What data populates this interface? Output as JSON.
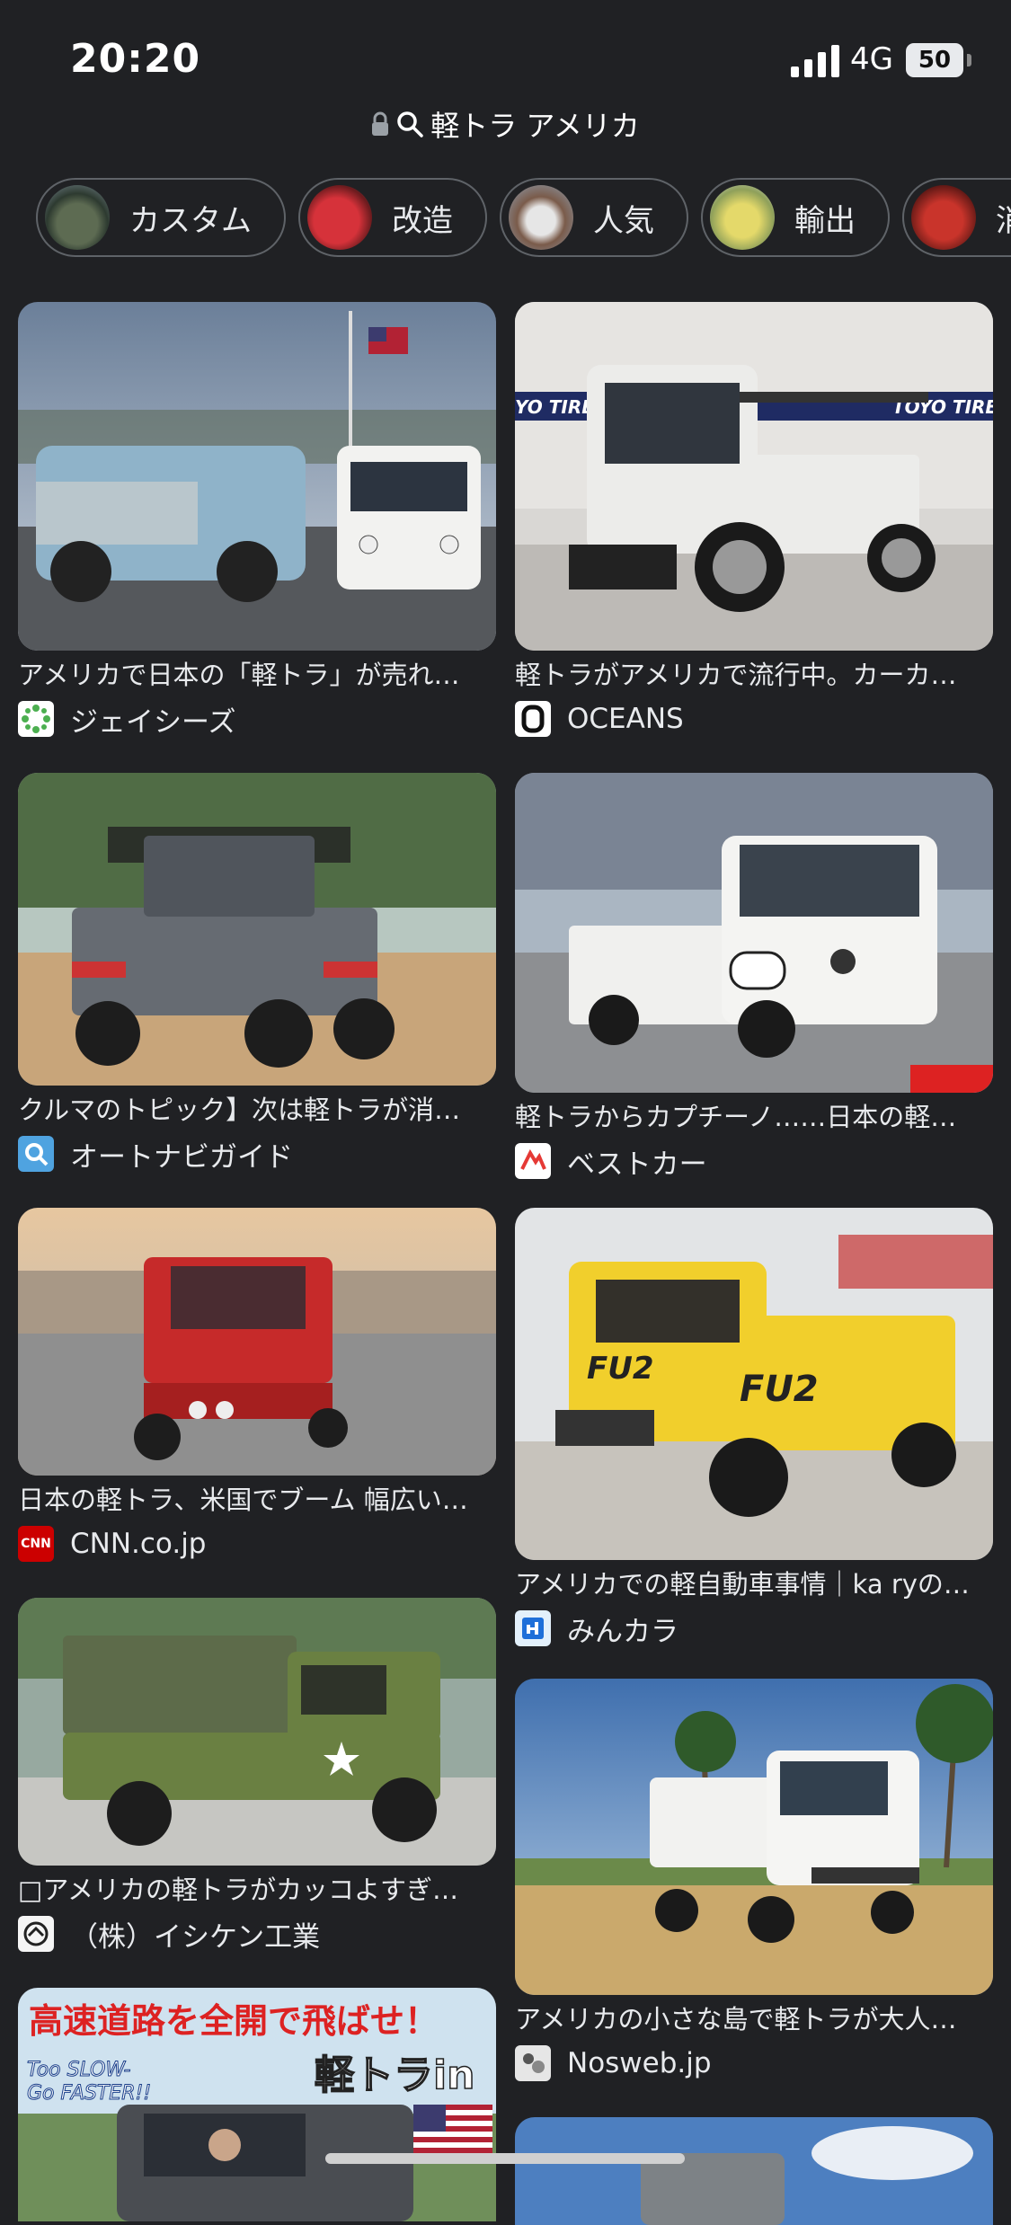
{
  "status": {
    "time": "20:20",
    "network": "4G",
    "battery": "50"
  },
  "url": {
    "query": "軽トラ アメリカ"
  },
  "chips": [
    {
      "label": "カスタム",
      "color": "#3f4d3a"
    },
    {
      "label": "改造",
      "color": "#b2282a"
    },
    {
      "label": "人気",
      "color": "#6c7a8c"
    },
    {
      "label": "輸出",
      "color": "#b8b27a"
    },
    {
      "label": "消",
      "color": "#a0322a"
    }
  ],
  "results": [
    {
      "title": "アメリカで日本の「軽トラ」が売れ…",
      "source": "ジェイシーズ",
      "favicon_color": "#2e7d32",
      "icon": "truck-photo-icon"
    },
    {
      "title": "軽トラがアメリカで流行中。カーカ…",
      "source": "OCEANS",
      "favicon_color": "#ffffff",
      "icon": "truck-photo-icon"
    },
    {
      "title": "クルマのトピック】次は軽トラが消…",
      "source": "オートナビガイド",
      "favicon_color": "#1e88e5",
      "icon": "truck-photo-icon"
    },
    {
      "title": "軽トラからカプチーノ……日本の軽…",
      "source": "ベストカー",
      "favicon_color": "#ffffff",
      "icon": "truck-photo-icon"
    },
    {
      "title": "日本の軽トラ、米国でブーム 幅広い…",
      "source": "CNN.co.jp",
      "favicon_color": "#cc0000",
      "favicon_text": "CNN",
      "icon": "truck-photo-icon"
    },
    {
      "title": "アメリカでの軽自動車事情｜ka ryの…",
      "source": "みんカラ",
      "favicon_color": "#1e6fd9",
      "icon": "truck-photo-icon"
    },
    {
      "title": "□アメリカの軽トラがカッコよすぎ…",
      "source": "（株）イシケン工業",
      "favicon_color": "#f5f5f5",
      "icon": "truck-photo-icon"
    },
    {
      "title": "アメリカの小さな島で軽トラが大人…",
      "source": "Nosweb.jp",
      "favicon_color": "#e0e0e0",
      "icon": "truck-photo-icon"
    },
    {
      "title": "高速道路を全開で飛ばせ！ Too SLOW- Go FASTER!! 軽トラin",
      "source": "",
      "icon": "truck-photo-icon"
    }
  ]
}
